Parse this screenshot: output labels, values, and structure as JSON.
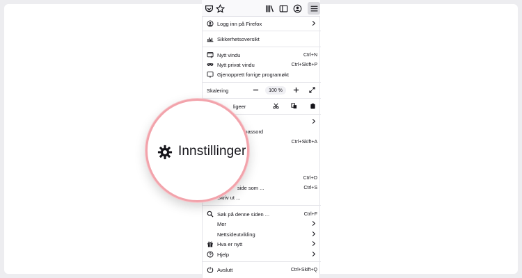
{
  "colors": {
    "page_bg": "#ededf0",
    "magnifier_ring": "#f2a3ab",
    "text": "#15141a"
  },
  "toolbar": {
    "icons": [
      "pocket-icon",
      "bookmark-star-icon",
      "library-icon",
      "sidebar-icon",
      "account-icon",
      "hamburger-menu-icon"
    ]
  },
  "menu": {
    "sign_in": "Logg inn på Firefox",
    "security": "Sikkerhetsoversikt",
    "new_window": {
      "label": "Nytt vindu",
      "shortcut": "Ctrl+N"
    },
    "private_window": {
      "label": "Nytt privat vindu",
      "shortcut": "Ctrl+Skift+P"
    },
    "restore": "Gjenopprett forrige programøkt",
    "zoom": {
      "label": "Skalering",
      "value": "100 %"
    },
    "edit_partial": "ligeer",
    "passwords_partial": "og passord",
    "addons_shortcut": "Ctrl+Skift+A",
    "open_shortcut": "Ctrl+O",
    "save": {
      "label": "side som ...",
      "shortcut": "Ctrl+S"
    },
    "print": "Skriv ut ...",
    "find": {
      "label": "Søk på denne siden ...",
      "shortcut": "Ctrl+F"
    },
    "more": "Mer",
    "webdev": "Nettsideutvikling",
    "whats_new": "Hva er nytt",
    "help": "Hjelp",
    "quit": {
      "label": "Avslutt",
      "shortcut": "Ctrl+Skift+Q"
    }
  },
  "magnifier": {
    "label": "Innstillinger",
    "icon": "gear-icon"
  }
}
